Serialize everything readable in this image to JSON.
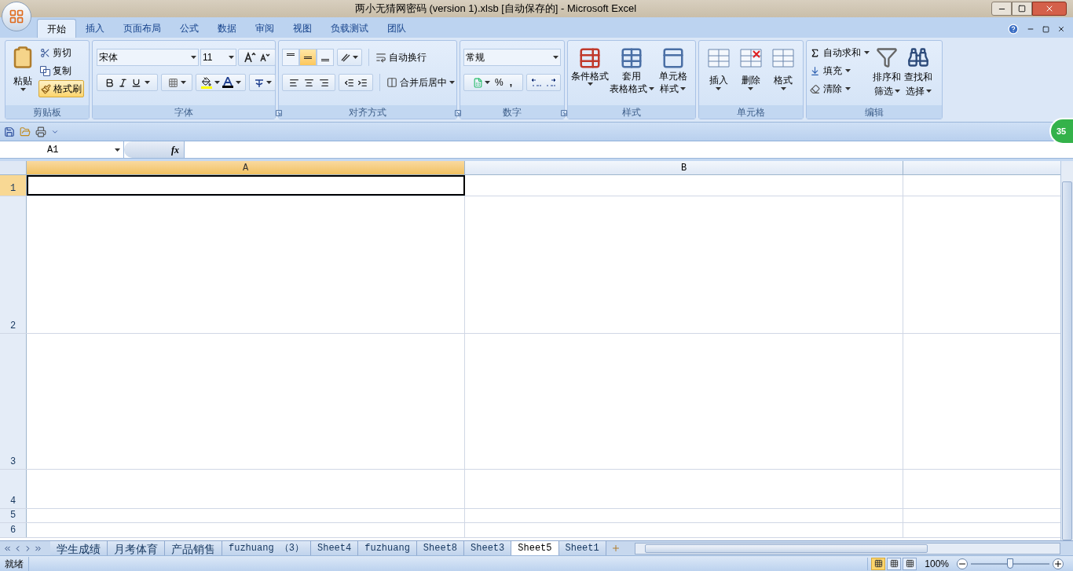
{
  "window": {
    "title": "两小无猜网密码 (version 1).xlsb [自动保存的] - Microsoft Excel"
  },
  "ribbon": {
    "tabs": [
      {
        "label": "开始",
        "selected": true
      },
      {
        "label": "插入",
        "selected": false
      },
      {
        "label": "页面布局",
        "selected": false
      },
      {
        "label": "公式",
        "selected": false
      },
      {
        "label": "数据",
        "selected": false
      },
      {
        "label": "审阅",
        "selected": false
      },
      {
        "label": "视图",
        "selected": false
      },
      {
        "label": "负载测试",
        "selected": false
      },
      {
        "label": "团队",
        "selected": false
      }
    ],
    "clipboard": {
      "label": "剪贴板",
      "paste": "粘贴",
      "cut": "剪切",
      "copy": "复制",
      "format_painter": {
        "label": "格式刷",
        "selected": true
      }
    },
    "font": {
      "label": "字体",
      "font_name": "宋体",
      "font_size": "11"
    },
    "alignment": {
      "label": "对齐方式",
      "vertical": [
        {
          "selected": false
        },
        {
          "selected": true
        },
        {
          "selected": false
        }
      ],
      "wrap": "自动换行",
      "merge": "合并后居中"
    },
    "number": {
      "label": "数字",
      "format": "常规",
      "percent": "%",
      "comma": ","
    },
    "styles": {
      "label": "样式",
      "buttons": [
        {
          "lines": [
            "条件格式"
          ]
        },
        {
          "lines": [
            "套用",
            "表格格式"
          ]
        },
        {
          "lines": [
            "单元格",
            "样式"
          ]
        }
      ]
    },
    "cells": {
      "label": "单元格",
      "buttons": [
        "插入",
        "删除",
        "格式"
      ]
    },
    "editing": {
      "label": "编辑",
      "autosum": "自动求和",
      "fill": "填充",
      "clear": "清除",
      "sort": [
        "排序和",
        "筛选"
      ],
      "find": [
        "查找和",
        "选择"
      ]
    }
  },
  "badge": "35",
  "formula_bar": {
    "name_box": "A1",
    "function_label": "fx"
  },
  "sheet": {
    "columns": [
      {
        "label": "A",
        "selected": true
      },
      {
        "label": "B",
        "selected": false
      }
    ],
    "rows": [
      {
        "label": "1",
        "selected": true
      },
      {
        "label": "2",
        "selected": false
      },
      {
        "label": "3",
        "selected": false
      },
      {
        "label": "4",
        "selected": false
      },
      {
        "label": "5",
        "selected": false
      },
      {
        "label": "6",
        "selected": false
      }
    ]
  },
  "sheet_tabs": [
    {
      "label": "学生成绩",
      "selected": false
    },
    {
      "label": "月考体育",
      "selected": false
    },
    {
      "label": "产品销售",
      "selected": false
    },
    {
      "label": "fuzhuang （3）",
      "selected": false
    },
    {
      "label": "Sheet4",
      "selected": false
    },
    {
      "label": "fuzhuang",
      "selected": false
    },
    {
      "label": "Sheet8",
      "selected": false
    },
    {
      "label": "Sheet3",
      "selected": false
    },
    {
      "label": "Sheet5",
      "selected": true
    },
    {
      "label": "Sheet1",
      "selected": false
    }
  ],
  "status_bar": {
    "status": "就绪",
    "views": [
      {
        "selected": true
      },
      {
        "selected": false
      },
      {
        "selected": false
      }
    ],
    "zoom": "100%",
    "zoom_slider": {
      "level": 0.5
    }
  }
}
